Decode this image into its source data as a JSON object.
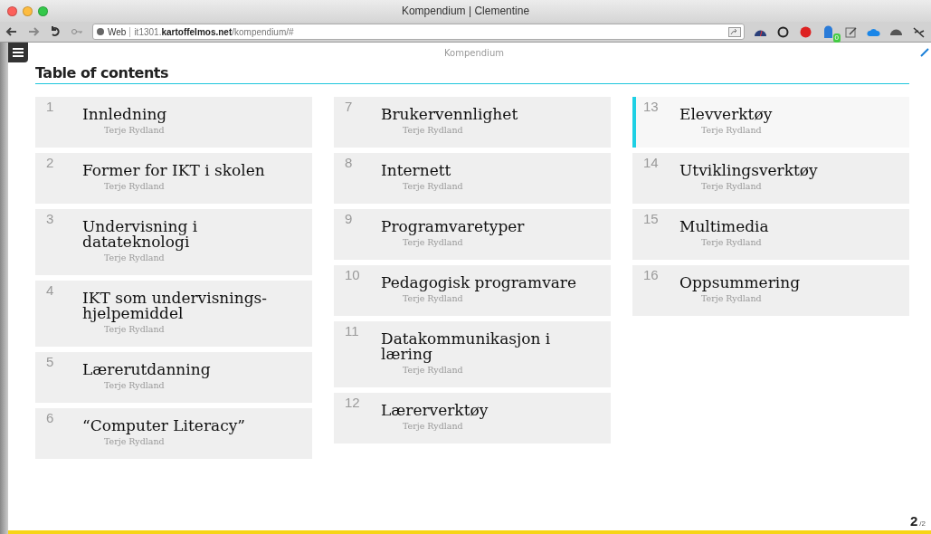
{
  "window": {
    "title": "Kompendium | Clementine"
  },
  "toolbar": {
    "site_chip": "Web",
    "url": "it1301.**kartoffelmos.net**/kompendium/#",
    "extension_badge": "0"
  },
  "page": {
    "header": "Kompendium",
    "heading": "Table of contents"
  },
  "columns": [
    [
      {
        "number": "1",
        "title": "Innledning",
        "author": "Terje Rydland",
        "selected": false
      },
      {
        "number": "2",
        "title": "Former for IKT i skolen",
        "author": "Terje Rydland",
        "selected": false
      },
      {
        "number": "3",
        "title": "Undervisning i datateknologi",
        "author": "Terje Rydland",
        "selected": false
      },
      {
        "number": "4",
        "title": "IKT som undervisnings-hjelpemiddel",
        "author": "Terje Rydland",
        "selected": false
      },
      {
        "number": "5",
        "title": "Lærerutdanning",
        "author": "Terje Rydland",
        "selected": false
      },
      {
        "number": "6",
        "title": "“Computer Literacy”",
        "author": "Terje Rydland",
        "selected": false
      }
    ],
    [
      {
        "number": "7",
        "title": "Brukervennlighet",
        "author": "Terje Rydland",
        "selected": false
      },
      {
        "number": "8",
        "title": "Internett",
        "author": "Terje Rydland",
        "selected": false
      },
      {
        "number": "9",
        "title": "Programvaretyper",
        "author": "Terje Rydland",
        "selected": false
      },
      {
        "number": "10",
        "title": "Pedagogisk programvare",
        "author": "Terje Rydland",
        "selected": false
      },
      {
        "number": "11",
        "title": "Datakommunikasjon i læring",
        "author": "Terje Rydland",
        "selected": false
      },
      {
        "number": "12",
        "title": "Lærerverktøy",
        "author": "Terje Rydland",
        "selected": false
      }
    ],
    [
      {
        "number": "13",
        "title": "Elevverktøy",
        "author": "Terje Rydland",
        "selected": true
      },
      {
        "number": "14",
        "title": "Utviklingsverktøy",
        "author": "Terje Rydland",
        "selected": false
      },
      {
        "number": "15",
        "title": "Multimedia",
        "author": "Terje Rydland",
        "selected": false
      },
      {
        "number": "16",
        "title": "Oppsummering",
        "author": "Terje Rydland",
        "selected": false
      }
    ]
  ],
  "pager": {
    "current": "2",
    "total": "/2"
  }
}
